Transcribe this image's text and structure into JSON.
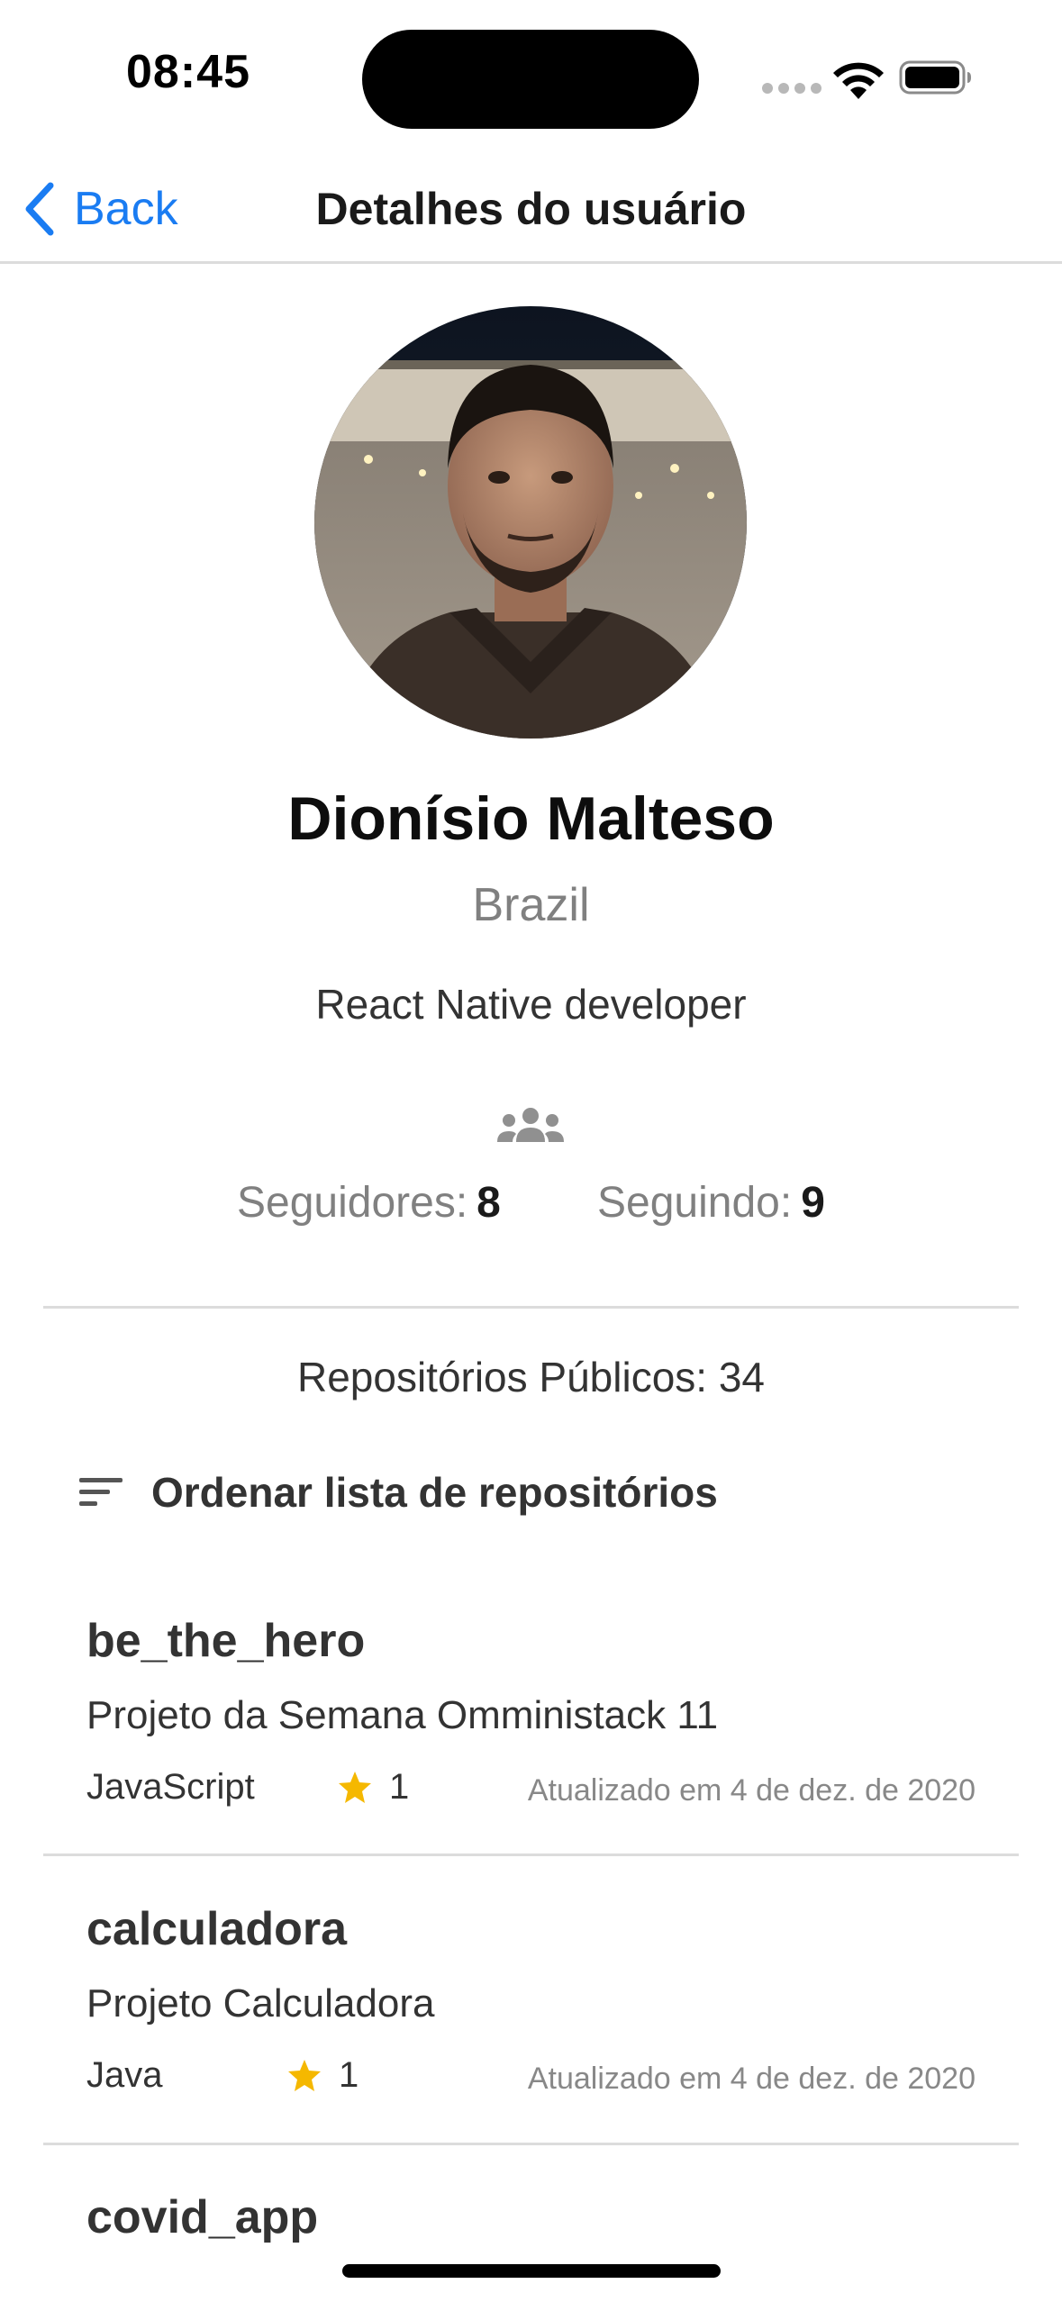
{
  "status_bar": {
    "time": "08:45"
  },
  "nav": {
    "back_label": "Back",
    "title": "Detalhes do usuário"
  },
  "profile": {
    "name": "Dionísio Malteso",
    "location": "Brazil",
    "bio": "React Native developer",
    "followers_label": "Seguidores:",
    "followers_count": "8",
    "following_label": "Seguindo:",
    "following_count": "9"
  },
  "repos": {
    "count_text": "Repositórios Públicos: 34",
    "sort_label": "Ordenar lista de repositórios",
    "items": [
      {
        "name": "be_the_hero",
        "description": "Projeto da Semana Omministack 11",
        "language": "JavaScript",
        "stars": "1",
        "updated": "Atualizado em 4 de dez. de 2020"
      },
      {
        "name": "calculadora",
        "description": "Projeto Calculadora",
        "language": "Java",
        "stars": "1",
        "updated": "Atualizado em 4 de dez. de 2020"
      },
      {
        "name": "covid_app"
      }
    ]
  },
  "colors": {
    "accent": "#1a7cf2",
    "star": "#f5b800",
    "secondary_text": "#808080"
  },
  "icons": {
    "back": "chevron-left-icon",
    "people": "people-icon",
    "sort": "sort-lines-icon",
    "star": "star-icon"
  }
}
